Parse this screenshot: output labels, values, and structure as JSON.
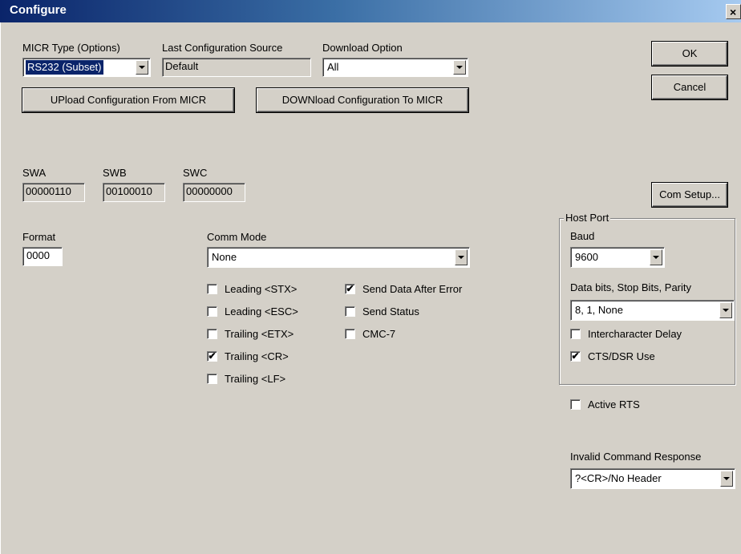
{
  "window": {
    "title": "Configure",
    "close_symbol": "×"
  },
  "micr_type": {
    "label": "MICR Type (Options)",
    "value": "RS232 (Subset)"
  },
  "last_config": {
    "label": "Last Configuration Source",
    "value": "Default"
  },
  "download_option": {
    "label": "Download Option",
    "value": "All"
  },
  "buttons": {
    "ok": "OK",
    "cancel": "Cancel",
    "upload": "UPload Configuration From MICR",
    "download": "DOWNload Configuration To MICR",
    "com_setup": "Com Setup..."
  },
  "switches": [
    {
      "label": "SWA",
      "value": "00000110"
    },
    {
      "label": "SWB",
      "value": "00100010"
    },
    {
      "label": "SWC",
      "value": "00000000"
    }
  ],
  "format": {
    "label": "Format",
    "value": "0000"
  },
  "comm_mode": {
    "label": "Comm Mode",
    "value": "None"
  },
  "options_left": [
    {
      "label": "Leading <STX>",
      "checked": false
    },
    {
      "label": "Leading <ESC>",
      "checked": false
    },
    {
      "label": "Trailing <ETX>",
      "checked": false
    },
    {
      "label": "Trailing <CR>",
      "checked": true
    },
    {
      "label": "Trailing <LF>",
      "checked": false
    }
  ],
  "options_right": [
    {
      "label": "Send Data After Error",
      "checked": true
    },
    {
      "label": "Send Status",
      "checked": false
    },
    {
      "label": "CMC-7",
      "checked": false
    }
  ],
  "host_port": {
    "group_label": "Host Port",
    "baud_label": "Baud",
    "baud_value": "9600",
    "data_label": "Data bits, Stop Bits, Parity",
    "data_value": "8, 1, None",
    "intercharacter_delay": {
      "label": "Intercharacter Delay",
      "checked": false
    },
    "cts_dsr": {
      "label": "CTS/DSR Use",
      "checked": true
    }
  },
  "active_rts": {
    "label": "Active RTS",
    "checked": false
  },
  "invalid_command": {
    "label": "Invalid Command Response",
    "value": "?<CR>/No Header"
  },
  "check_mark": "✔"
}
